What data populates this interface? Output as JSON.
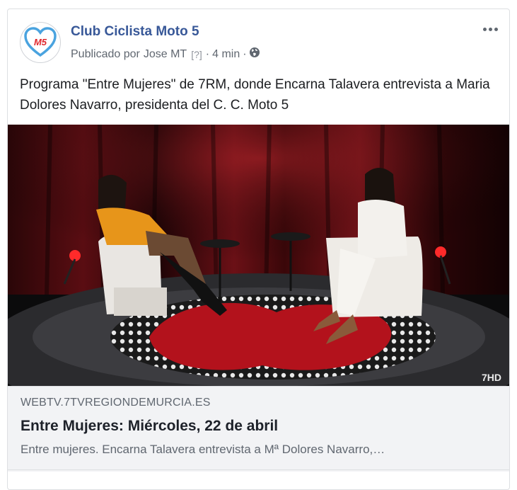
{
  "post": {
    "page_name": "Club Ciclista Moto 5",
    "avatar_text": "M5",
    "published_prefix": "Publicado por",
    "author": "Jose MT",
    "help_marker": "[?]",
    "separator": "·",
    "time": "4 min",
    "privacy_icon": "globe-icon",
    "more_icon": "more-options-icon",
    "text": "Programa \"Entre Mujeres\" de 7RM, donde Encarna Talavera entrevista a Maria Dolores Navarro, presidenta del C. C. Moto 5"
  },
  "media": {
    "watermark": "7HD",
    "description_icon": "video-thumbnail"
  },
  "link_preview": {
    "domain": "WEBTV.7TVREGIONDEMURCIA.ES",
    "title": "Entre Mujeres: Miércoles, 22 de abril",
    "description": "Entre mujeres. Encarna Talavera entrevista a Mª Dolores Navarro,…"
  },
  "colors": {
    "page_name": "#385898",
    "meta": "#606770",
    "link_bg": "#f2f3f5",
    "avatar_heart": "#4aa3df",
    "avatar_text": "#e0262b"
  }
}
